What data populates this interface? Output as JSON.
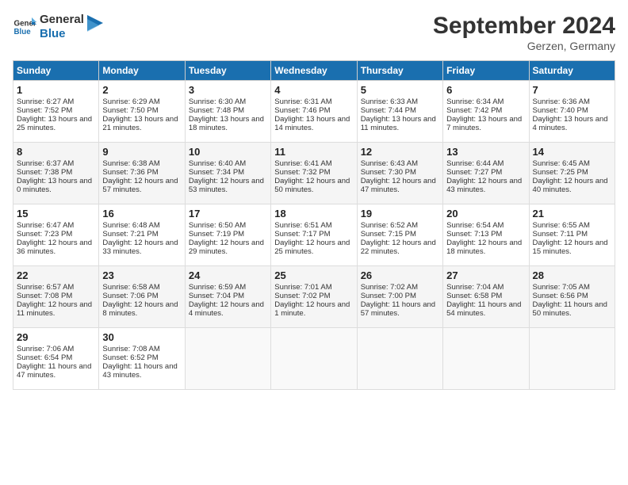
{
  "header": {
    "logo_line1": "General",
    "logo_line2": "Blue",
    "month_year": "September 2024",
    "location": "Gerzen, Germany"
  },
  "weekdays": [
    "Sunday",
    "Monday",
    "Tuesday",
    "Wednesday",
    "Thursday",
    "Friday",
    "Saturday"
  ],
  "weeks": [
    [
      {
        "day": "1",
        "sunrise": "6:27 AM",
        "sunset": "7:52 PM",
        "daylight": "13 hours and 25 minutes."
      },
      {
        "day": "2",
        "sunrise": "6:29 AM",
        "sunset": "7:50 PM",
        "daylight": "13 hours and 21 minutes."
      },
      {
        "day": "3",
        "sunrise": "6:30 AM",
        "sunset": "7:48 PM",
        "daylight": "13 hours and 18 minutes."
      },
      {
        "day": "4",
        "sunrise": "6:31 AM",
        "sunset": "7:46 PM",
        "daylight": "13 hours and 14 minutes."
      },
      {
        "day": "5",
        "sunrise": "6:33 AM",
        "sunset": "7:44 PM",
        "daylight": "13 hours and 11 minutes."
      },
      {
        "day": "6",
        "sunrise": "6:34 AM",
        "sunset": "7:42 PM",
        "daylight": "13 hours and 7 minutes."
      },
      {
        "day": "7",
        "sunrise": "6:36 AM",
        "sunset": "7:40 PM",
        "daylight": "13 hours and 4 minutes."
      }
    ],
    [
      {
        "day": "8",
        "sunrise": "6:37 AM",
        "sunset": "7:38 PM",
        "daylight": "13 hours and 0 minutes."
      },
      {
        "day": "9",
        "sunrise": "6:38 AM",
        "sunset": "7:36 PM",
        "daylight": "12 hours and 57 minutes."
      },
      {
        "day": "10",
        "sunrise": "6:40 AM",
        "sunset": "7:34 PM",
        "daylight": "12 hours and 53 minutes."
      },
      {
        "day": "11",
        "sunrise": "6:41 AM",
        "sunset": "7:32 PM",
        "daylight": "12 hours and 50 minutes."
      },
      {
        "day": "12",
        "sunrise": "6:43 AM",
        "sunset": "7:30 PM",
        "daylight": "12 hours and 47 minutes."
      },
      {
        "day": "13",
        "sunrise": "6:44 AM",
        "sunset": "7:27 PM",
        "daylight": "12 hours and 43 minutes."
      },
      {
        "day": "14",
        "sunrise": "6:45 AM",
        "sunset": "7:25 PM",
        "daylight": "12 hours and 40 minutes."
      }
    ],
    [
      {
        "day": "15",
        "sunrise": "6:47 AM",
        "sunset": "7:23 PM",
        "daylight": "12 hours and 36 minutes."
      },
      {
        "day": "16",
        "sunrise": "6:48 AM",
        "sunset": "7:21 PM",
        "daylight": "12 hours and 33 minutes."
      },
      {
        "day": "17",
        "sunrise": "6:50 AM",
        "sunset": "7:19 PM",
        "daylight": "12 hours and 29 minutes."
      },
      {
        "day": "18",
        "sunrise": "6:51 AM",
        "sunset": "7:17 PM",
        "daylight": "12 hours and 25 minutes."
      },
      {
        "day": "19",
        "sunrise": "6:52 AM",
        "sunset": "7:15 PM",
        "daylight": "12 hours and 22 minutes."
      },
      {
        "day": "20",
        "sunrise": "6:54 AM",
        "sunset": "7:13 PM",
        "daylight": "12 hours and 18 minutes."
      },
      {
        "day": "21",
        "sunrise": "6:55 AM",
        "sunset": "7:11 PM",
        "daylight": "12 hours and 15 minutes."
      }
    ],
    [
      {
        "day": "22",
        "sunrise": "6:57 AM",
        "sunset": "7:08 PM",
        "daylight": "12 hours and 11 minutes."
      },
      {
        "day": "23",
        "sunrise": "6:58 AM",
        "sunset": "7:06 PM",
        "daylight": "12 hours and 8 minutes."
      },
      {
        "day": "24",
        "sunrise": "6:59 AM",
        "sunset": "7:04 PM",
        "daylight": "12 hours and 4 minutes."
      },
      {
        "day": "25",
        "sunrise": "7:01 AM",
        "sunset": "7:02 PM",
        "daylight": "12 hours and 1 minute."
      },
      {
        "day": "26",
        "sunrise": "7:02 AM",
        "sunset": "7:00 PM",
        "daylight": "11 hours and 57 minutes."
      },
      {
        "day": "27",
        "sunrise": "7:04 AM",
        "sunset": "6:58 PM",
        "daylight": "11 hours and 54 minutes."
      },
      {
        "day": "28",
        "sunrise": "7:05 AM",
        "sunset": "6:56 PM",
        "daylight": "11 hours and 50 minutes."
      }
    ],
    [
      {
        "day": "29",
        "sunrise": "7:06 AM",
        "sunset": "6:54 PM",
        "daylight": "11 hours and 47 minutes."
      },
      {
        "day": "30",
        "sunrise": "7:08 AM",
        "sunset": "6:52 PM",
        "daylight": "11 hours and 43 minutes."
      },
      null,
      null,
      null,
      null,
      null
    ]
  ]
}
